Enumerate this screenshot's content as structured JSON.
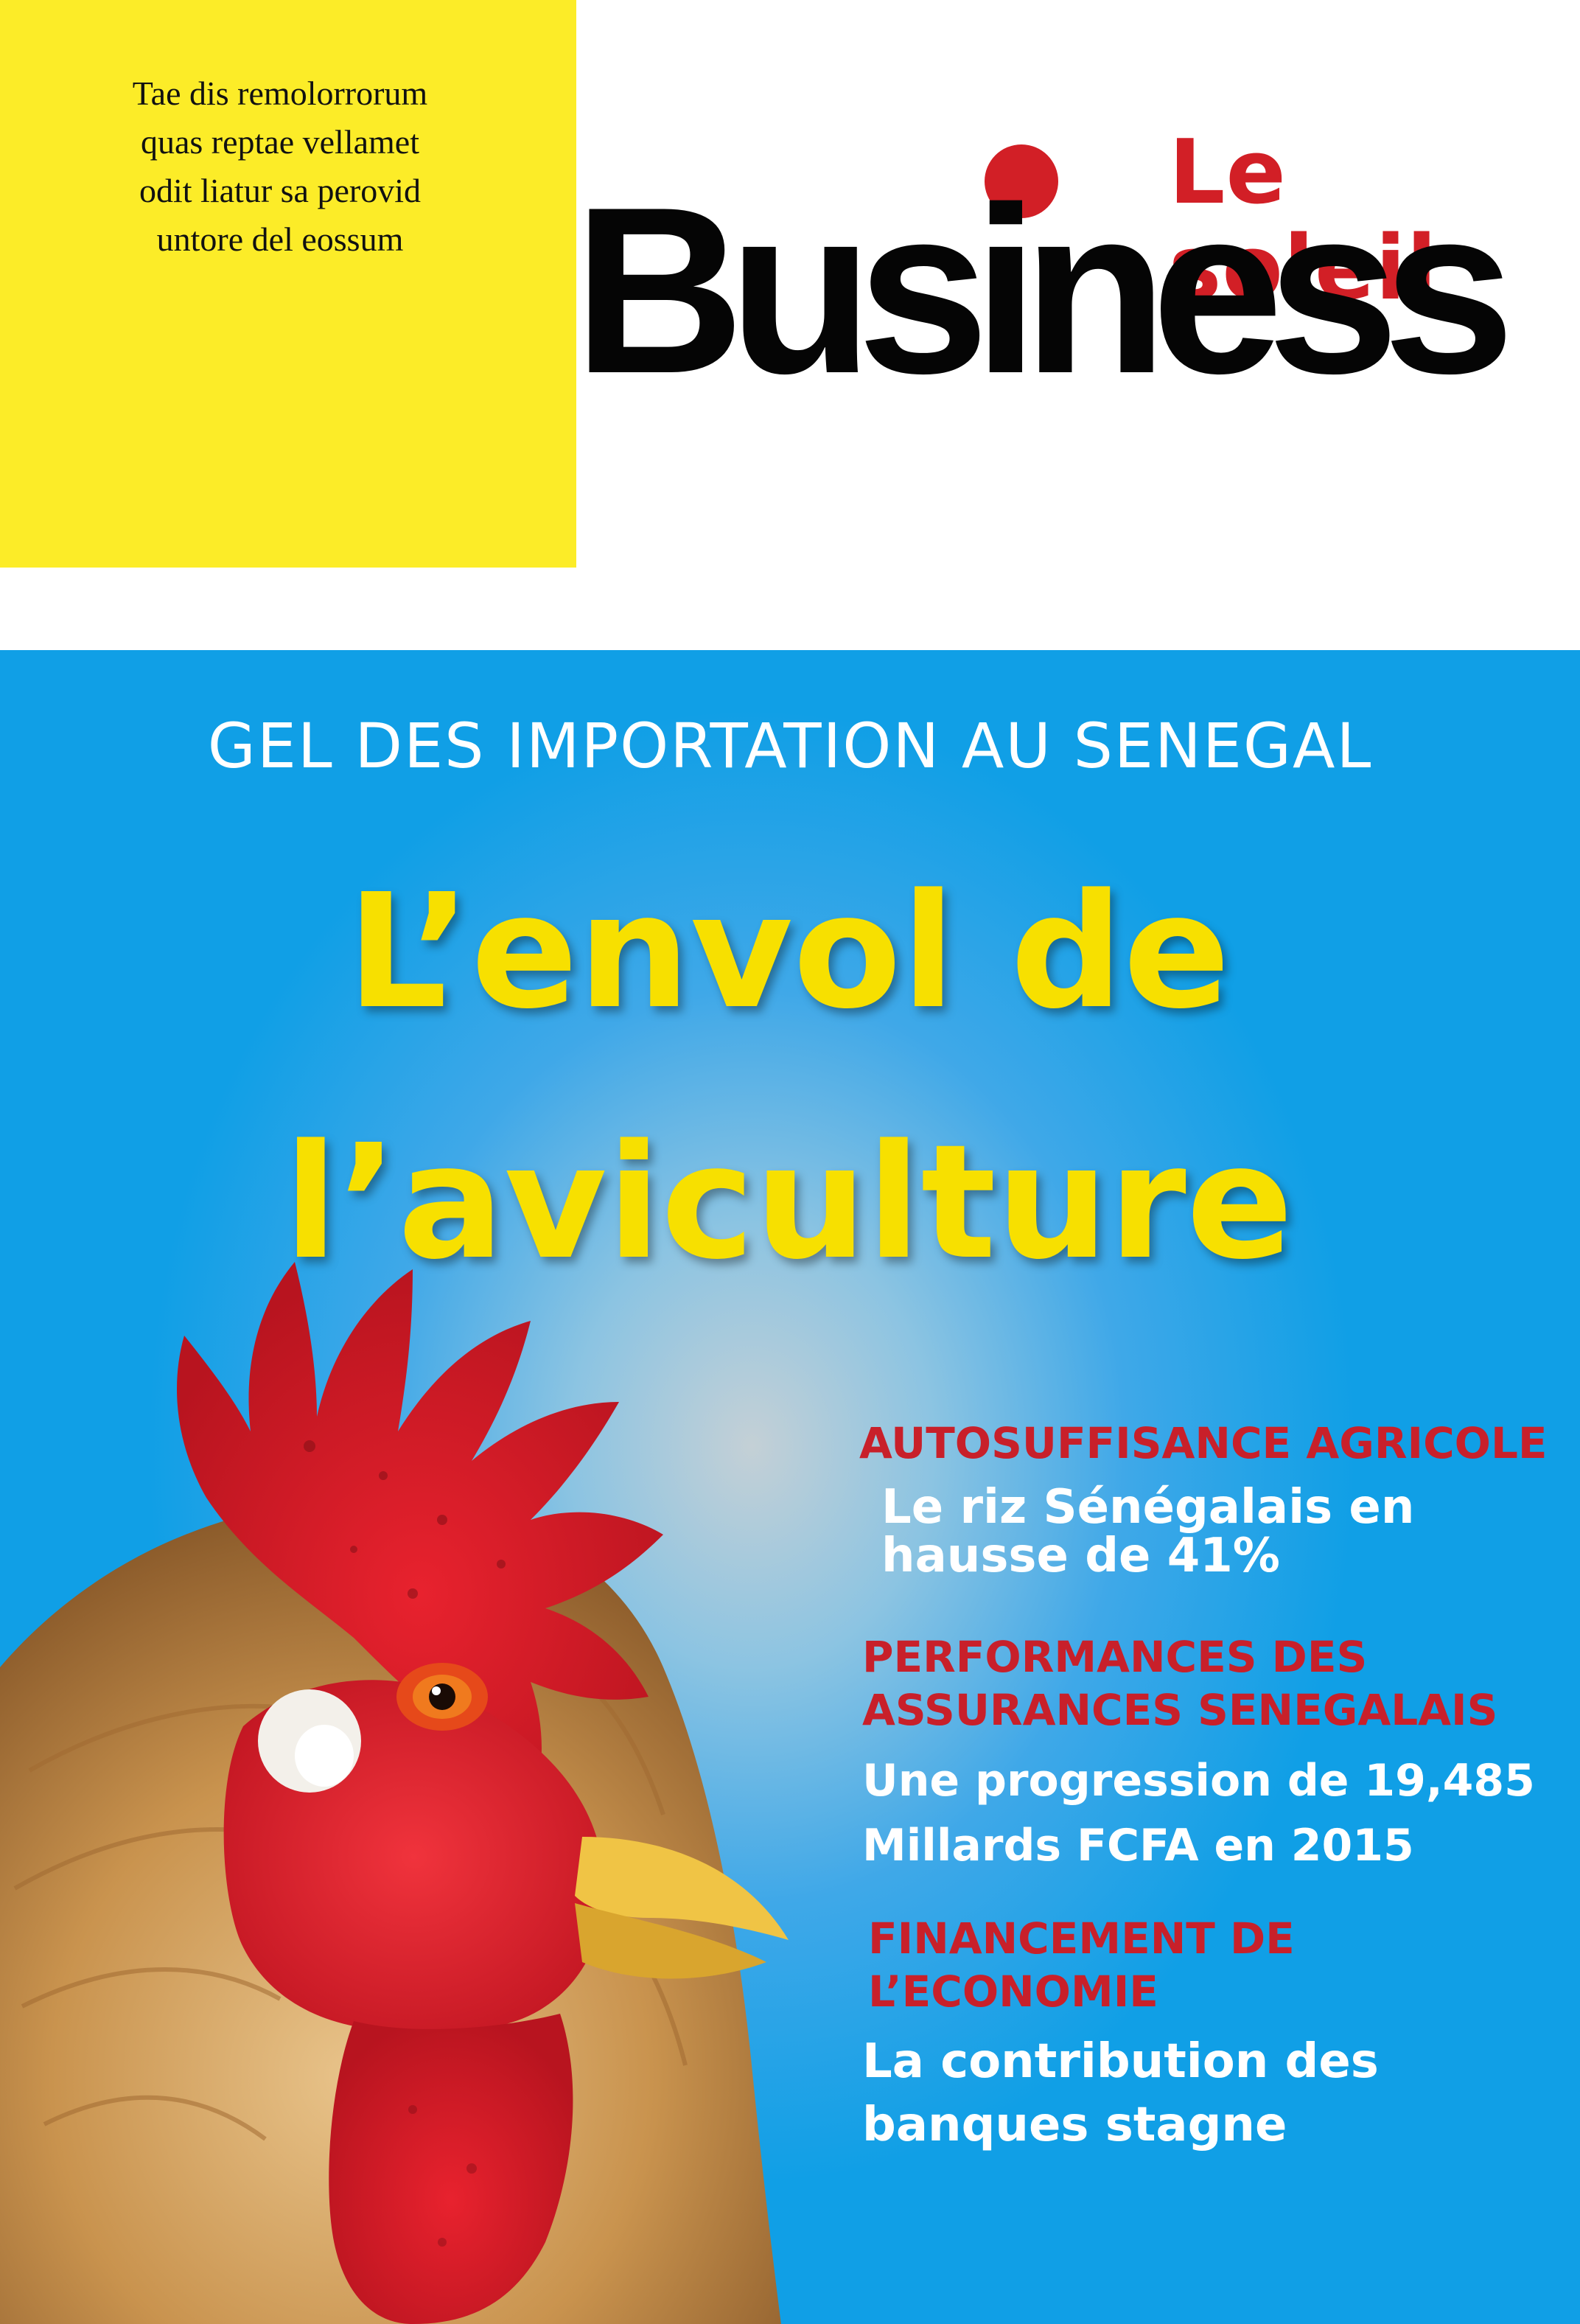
{
  "teaser": {
    "lines": [
      "Tae dis remolorrorum",
      "quas reptae vellamet",
      "odit liatur sa perovid",
      "untore del eossum"
    ]
  },
  "brand": {
    "sub": "Le soleil",
    "main": "Business",
    "dot_color": "#d21f26"
  },
  "cover": {
    "kicker": "GEL DES IMPORTATION AU SENEGAL",
    "headline_lines": [
      "L’envol de",
      "l’aviculture"
    ],
    "image": "rooster-head"
  },
  "stories": [
    {
      "kicker_lines": [
        "AUTOSUFFISANCE AGRICOLE"
      ],
      "deck_lines": [
        "Le riz Sénégalais en",
        "hausse de 41%"
      ]
    },
    {
      "kicker_lines": [
        "PERFORMANCES DES",
        "ASSURANCES SENEGALAIS"
      ],
      "deck_lines": [
        "Une progression de 19,485",
        "Millards FCFA en 2015"
      ]
    },
    {
      "kicker_lines": [
        "FINANCEMENT DE",
        "L’ECONOMIE"
      ],
      "deck_lines": [
        "La contribution des",
        "banques stagne"
      ]
    }
  ],
  "colors": {
    "yellow": "#fcec28",
    "headline_yellow": "#f7e000",
    "accent_red": "#c8202a",
    "sky_blue": "#109fe6"
  }
}
